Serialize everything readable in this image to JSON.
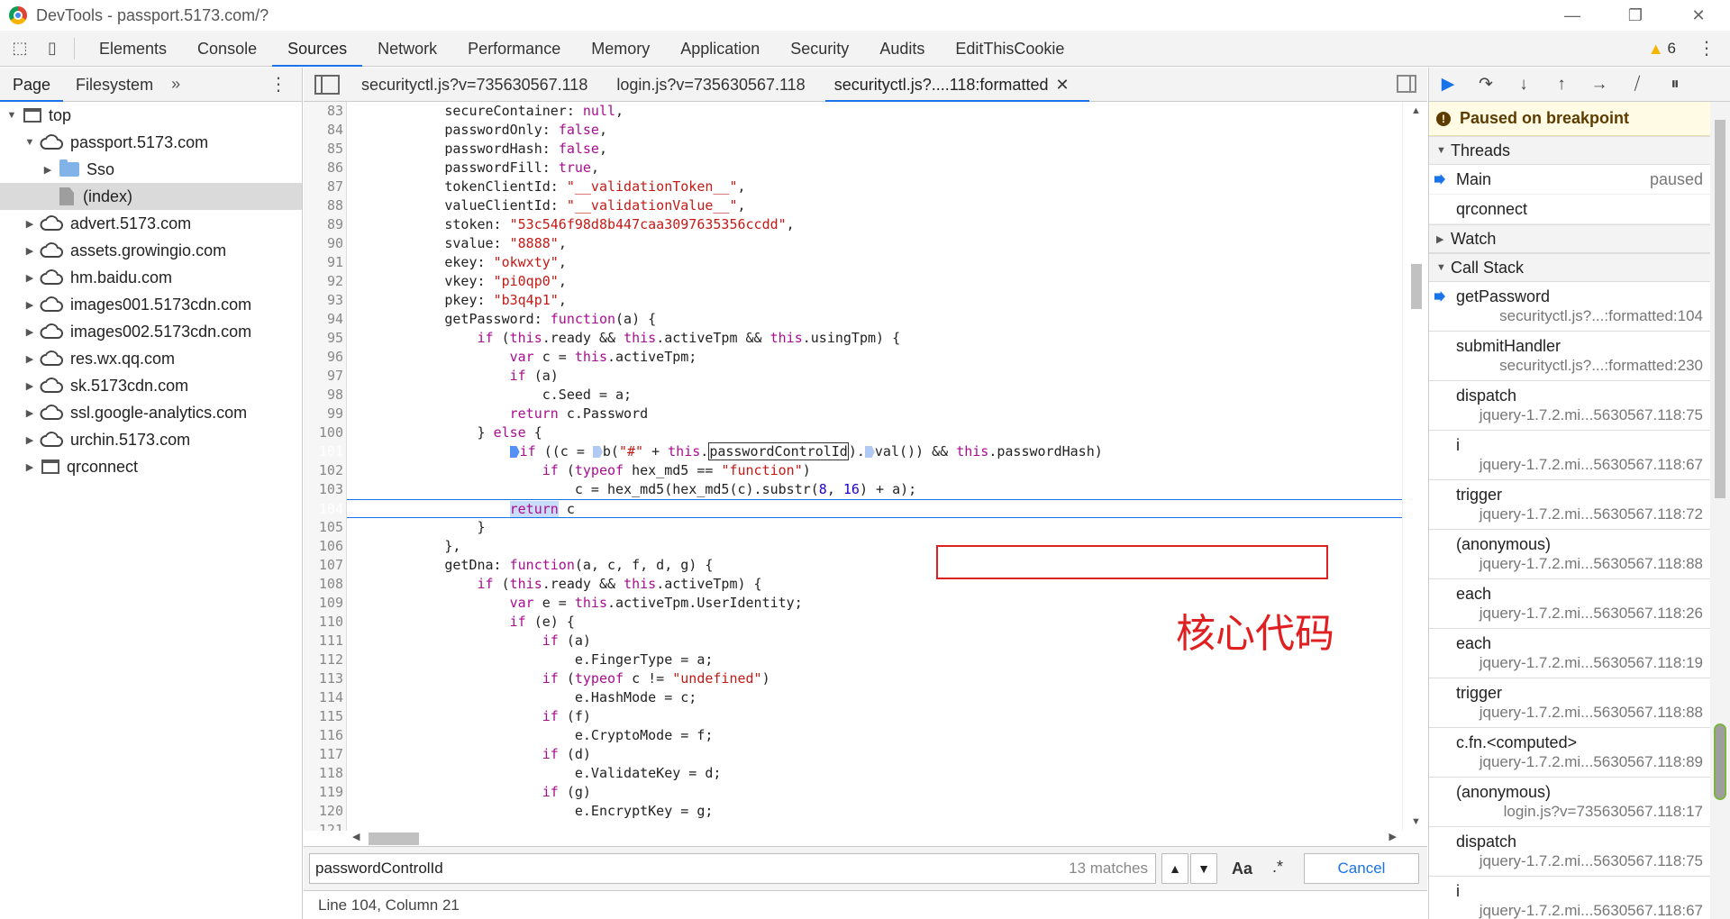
{
  "window": {
    "title": "DevTools - passport.5173.com/?",
    "controls": [
      "—",
      "❐",
      "✕"
    ]
  },
  "main_tabs": [
    "Elements",
    "Console",
    "Sources",
    "Network",
    "Performance",
    "Memory",
    "Application",
    "Security",
    "Audits",
    "EditThisCookie"
  ],
  "active_main_tab": "Sources",
  "warnings": {
    "count": "6"
  },
  "navigator": {
    "tabs": [
      "Page",
      "Filesystem"
    ],
    "more": "»",
    "tree": [
      {
        "label": "top",
        "icon": "frame-icon",
        "depth": 0,
        "expanded": true
      },
      {
        "label": "passport.5173.com",
        "icon": "cloud-icon",
        "depth": 1,
        "expanded": true
      },
      {
        "label": "Sso",
        "icon": "folder-icon",
        "depth": 2,
        "expanded": false
      },
      {
        "label": "(index)",
        "icon": "file-icon",
        "depth": 2,
        "selected": true
      },
      {
        "label": "advert.5173.com",
        "icon": "cloud-icon",
        "depth": 1
      },
      {
        "label": "assets.growingio.com",
        "icon": "cloud-icon",
        "depth": 1
      },
      {
        "label": "hm.baidu.com",
        "icon": "cloud-icon",
        "depth": 1
      },
      {
        "label": "images001.5173cdn.com",
        "icon": "cloud-icon",
        "depth": 1
      },
      {
        "label": "images002.5173cdn.com",
        "icon": "cloud-icon",
        "depth": 1
      },
      {
        "label": "res.wx.qq.com",
        "icon": "cloud-icon",
        "depth": 1
      },
      {
        "label": "sk.5173cdn.com",
        "icon": "cloud-icon",
        "depth": 1
      },
      {
        "label": "ssl.google-analytics.com",
        "icon": "cloud-icon",
        "depth": 1
      },
      {
        "label": "urchin.5173.com",
        "icon": "cloud-icon",
        "depth": 1
      },
      {
        "label": "qrconnect",
        "icon": "frame-icon",
        "depth": 1
      }
    ]
  },
  "editor": {
    "tabs": [
      {
        "label": "securityctl.js?v=735630567.118",
        "active": false
      },
      {
        "label": "login.js?v=735630567.118",
        "active": false
      },
      {
        "label": "securityctl.js?....118:formatted",
        "active": true,
        "closable": true
      }
    ],
    "annotation": "核心代码",
    "search": {
      "value": "passwordControlId",
      "matches": "13 matches",
      "case_label": "Aa",
      "regex_label": ".*",
      "cancel_label": "Cancel"
    },
    "status": "Line 104, Column 21"
  },
  "debugger": {
    "paused_label": "Paused on breakpoint",
    "threads_label": "Threads",
    "threads": [
      {
        "name": "Main",
        "status": "paused",
        "current": true
      },
      {
        "name": "qrconnect",
        "status": ""
      }
    ],
    "watch_label": "Watch",
    "callstack_label": "Call Stack",
    "call_stack": [
      {
        "fn": "getPassword",
        "loc": "securityctl.js?...:formatted:104",
        "current": true
      },
      {
        "fn": "submitHandler",
        "loc": "securityctl.js?...:formatted:230"
      },
      {
        "fn": "dispatch",
        "loc": "jquery-1.7.2.mi...5630567.118:75"
      },
      {
        "fn": "i",
        "loc": "jquery-1.7.2.mi...5630567.118:67"
      },
      {
        "fn": "trigger",
        "loc": "jquery-1.7.2.mi...5630567.118:72"
      },
      {
        "fn": "(anonymous)",
        "loc": "jquery-1.7.2.mi...5630567.118:88"
      },
      {
        "fn": "each",
        "loc": "jquery-1.7.2.mi...5630567.118:26"
      },
      {
        "fn": "each",
        "loc": "jquery-1.7.2.mi...5630567.118:19"
      },
      {
        "fn": "trigger",
        "loc": "jquery-1.7.2.mi...5630567.118:88"
      },
      {
        "fn": "c.fn.<computed>",
        "loc": "jquery-1.7.2.mi...5630567.118:89"
      },
      {
        "fn": "(anonymous)",
        "loc": "login.js?v=735630567.118:17"
      },
      {
        "fn": "dispatch",
        "loc": "jquery-1.7.2.mi...5630567.118:75"
      },
      {
        "fn": "i",
        "loc": "jquery-1.7.2.mi...5630567.118:67"
      }
    ]
  },
  "code_lines": [
    {
      "n": "83",
      "html": "            secureContainer: <span class=\"lit\">null</span>,"
    },
    {
      "n": "84",
      "html": "            passwordOnly: <span class=\"lit\">false</span>,"
    },
    {
      "n": "85",
      "html": "            passwordHash: <span class=\"lit\">false</span>,"
    },
    {
      "n": "86",
      "html": "            passwordFill: <span class=\"lit\">true</span>,"
    },
    {
      "n": "87",
      "html": "            tokenClientId: <span class=\"str\">\"__validationToken__\"</span>,"
    },
    {
      "n": "88",
      "html": "            valueClientId: <span class=\"str\">\"__validationValue__\"</span>,"
    },
    {
      "n": "89",
      "html": "            stoken: <span class=\"str\">\"53c546f98d8b447caa3097635356ccdd\"</span>,"
    },
    {
      "n": "90",
      "html": "            svalue: <span class=\"str\">\"8888\"</span>,"
    },
    {
      "n": "91",
      "html": "            ekey: <span class=\"str\">\"okwxty\"</span>,"
    },
    {
      "n": "92",
      "html": "            vkey: <span class=\"str\">\"pi0qp0\"</span>,"
    },
    {
      "n": "93",
      "html": "            pkey: <span class=\"str\">\"b3q4p1\"</span>,"
    },
    {
      "n": "94",
      "html": "            getPassword: <span class=\"kw\">function</span>(a) {"
    },
    {
      "n": "95",
      "html": "                <span class=\"kw\">if</span> (<span class=\"kw\">this</span>.ready &amp;&amp; <span class=\"kw\">this</span>.activeTpm &amp;&amp; <span class=\"kw\">this</span>.usingTpm) {"
    },
    {
      "n": "96",
      "html": "                    <span class=\"kw\">var</span> c = <span class=\"kw\">this</span>.activeTpm;"
    },
    {
      "n": "97",
      "html": "                    <span class=\"kw\">if</span> (a)"
    },
    {
      "n": "98",
      "html": "                        c.Seed = a;"
    },
    {
      "n": "99",
      "html": "                    <span class=\"kw\">return</span> c.Password"
    },
    {
      "n": "100",
      "html": "                } <span class=\"kw\">else</span> {"
    },
    {
      "n": "101",
      "bp": true,
      "html": "                    <span class=\"inline-bp\"></span><span class=\"kw\">if</span> ((c = <span class=\"inline-bp light\"></span>b(<span class=\"str\">\"#\"</span> + <span class=\"kw\">this</span>.<span class=\"box\">passwordControlId</span>).<span class=\"inline-bp light\"></span>val()) &amp;&amp; <span class=\"kw\">this</span>.passwordHash)"
    },
    {
      "n": "102",
      "html": "                        <span class=\"kw\">if</span> (<span class=\"kw\">typeof</span> hex_md5 == <span class=\"str\">\"function\"</span>)"
    },
    {
      "n": "103",
      "html": "                            c = hex_md5(hex_md5(c).substr(<span class=\"num\">8</span>, <span class=\"num\">16</span>) + a);"
    },
    {
      "n": "104",
      "bp": true,
      "exec": true,
      "html": "                    <span class=\"kw sel-return\">return</span> c"
    },
    {
      "n": "105",
      "html": "                }"
    },
    {
      "n": "106",
      "html": "            },"
    },
    {
      "n": "107",
      "html": "            getDna: <span class=\"kw\">function</span>(a, c, f, d, g) {"
    },
    {
      "n": "108",
      "html": "                <span class=\"kw\">if</span> (<span class=\"kw\">this</span>.ready &amp;&amp; <span class=\"kw\">this</span>.activeTpm) {"
    },
    {
      "n": "109",
      "html": "                    <span class=\"kw\">var</span> e = <span class=\"kw\">this</span>.activeTpm.UserIdentity;"
    },
    {
      "n": "110",
      "html": "                    <span class=\"kw\">if</span> (e) {"
    },
    {
      "n": "111",
      "html": "                        <span class=\"kw\">if</span> (a)"
    },
    {
      "n": "112",
      "html": "                            e.FingerType = a;"
    },
    {
      "n": "113",
      "html": "                        <span class=\"kw\">if</span> (<span class=\"kw\">typeof</span> c != <span class=\"str\">\"undefined\"</span>)"
    },
    {
      "n": "114",
      "html": "                            e.HashMode = c;"
    },
    {
      "n": "115",
      "html": "                        <span class=\"kw\">if</span> (f)"
    },
    {
      "n": "116",
      "html": "                            e.CryptoMode = f;"
    },
    {
      "n": "117",
      "html": "                        <span class=\"kw\">if</span> (d)"
    },
    {
      "n": "118",
      "html": "                            e.ValidateKey = d;"
    },
    {
      "n": "119",
      "html": "                        <span class=\"kw\">if</span> (g)"
    },
    {
      "n": "120",
      "html": "                            e.EncryptKey = g;"
    },
    {
      "n": "121",
      "html": ""
    }
  ]
}
